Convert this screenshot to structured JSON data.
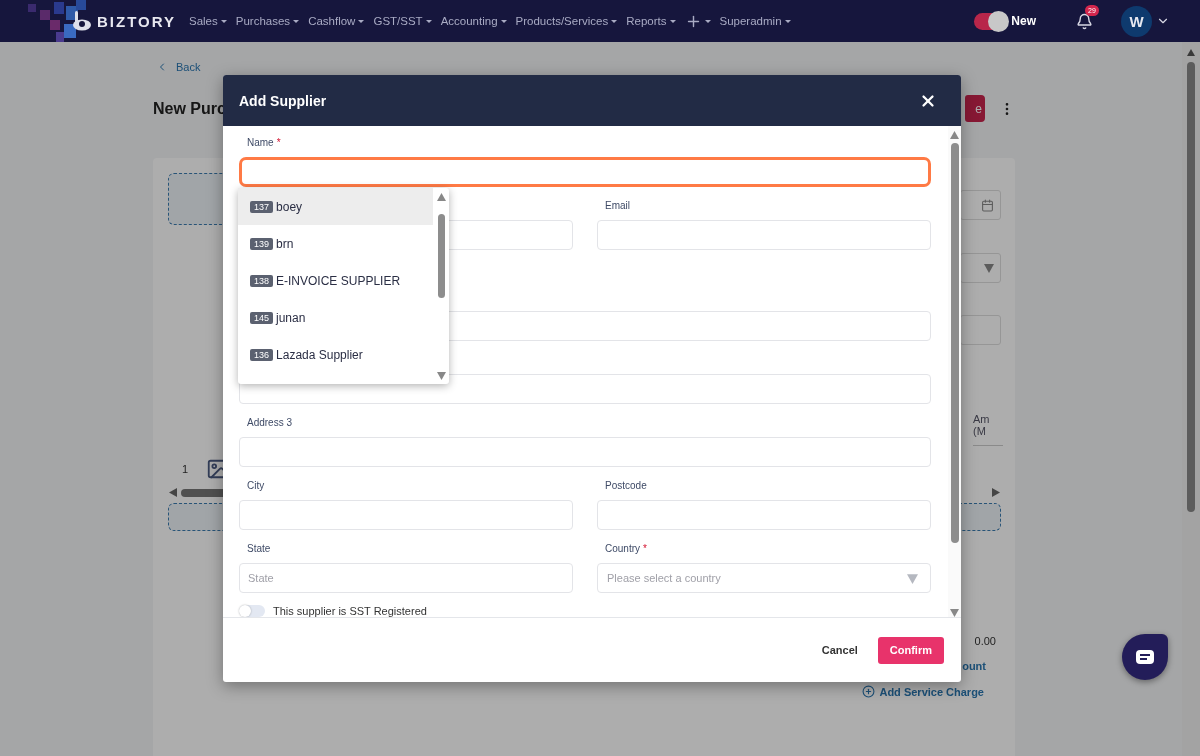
{
  "nav": {
    "logo": "BIZTORY",
    "menu": [
      {
        "kind": "text",
        "label": "Sales"
      },
      {
        "kind": "text",
        "label": "Purchases"
      },
      {
        "kind": "text",
        "label": "Cashflow"
      },
      {
        "kind": "text",
        "label": "GST/SST"
      },
      {
        "kind": "text",
        "label": "Accounting"
      },
      {
        "kind": "text",
        "label": "Products/Services"
      },
      {
        "kind": "text",
        "label": "Reports"
      },
      {
        "kind": "add"
      },
      {
        "kind": "text",
        "label": "Superadmin"
      }
    ],
    "new_toggle": {
      "label": "New",
      "on": true
    },
    "notifications": {
      "count": "29"
    },
    "avatar": {
      "initial": "W"
    }
  },
  "page": {
    "back": "Back",
    "title": "New Purc",
    "action_button": "e",
    "amount_header": [
      "Am",
      "(M"
    ],
    "row_number": "1",
    "total": "0.00",
    "discount_link": "ount",
    "service_charge_link": "Add Service Charge"
  },
  "modal": {
    "title": "Add Supplier",
    "rows": [
      {
        "fields": [
          {
            "kind": "text",
            "label": "Name",
            "required_mark": "*",
            "focused": true
          }
        ]
      },
      {
        "fields": [
          {
            "kind": "text",
            "focused": false
          },
          {
            "kind": "text",
            "label": "Email",
            "focused": false
          }
        ]
      },
      {
        "fields": [
          {
            "kind": "text",
            "focused": false
          }
        ]
      },
      {
        "fields": [
          {
            "kind": "text",
            "focused": false
          }
        ]
      },
      {
        "fields": [
          {
            "kind": "text",
            "label": "Address 3",
            "focused": false
          }
        ]
      },
      {
        "fields": [
          {
            "kind": "text",
            "label": "City",
            "focused": false
          },
          {
            "kind": "text",
            "label": "Postcode",
            "focused": false
          }
        ]
      },
      {
        "fields": [
          {
            "kind": "text",
            "label": "State",
            "focused": false,
            "placeholder": "State"
          },
          {
            "kind": "select",
            "label": "Country",
            "required_mark": "*",
            "focused": false,
            "placeholder": "Please select a country"
          }
        ]
      }
    ],
    "sst_toggle": {
      "label": "This supplier is SST Registered",
      "on": false
    },
    "buttons": [
      {
        "kind": "text",
        "label": "Cancel"
      },
      {
        "kind": "primary",
        "label": "Confirm"
      }
    ]
  },
  "suggestions": [
    {
      "id": "137",
      "name": "boey",
      "selected": true
    },
    {
      "id": "139",
      "name": "brn",
      "selected": false
    },
    {
      "id": "138",
      "name": "E-INVOICE SUPPLIER",
      "selected": false
    },
    {
      "id": "145",
      "name": "junan",
      "selected": false
    },
    {
      "id": "136",
      "name": "Lazada Supplier",
      "selected": false
    }
  ]
}
